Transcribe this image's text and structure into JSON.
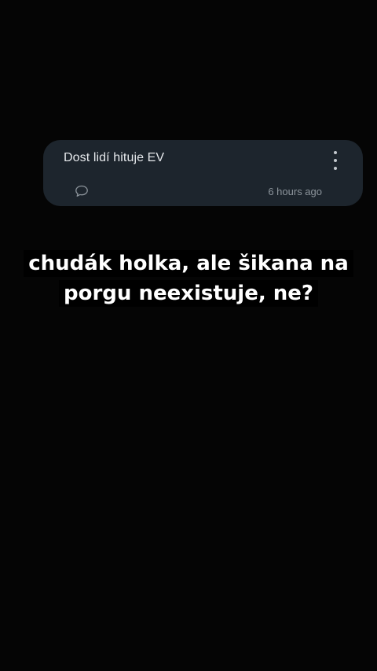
{
  "comment": {
    "text": "Dost lidí hituje EV",
    "timestamp": "6 hours ago",
    "reply_icon": "speech-bubble-icon",
    "menu_icon": "more-vertical-icon"
  },
  "caption": {
    "line1": "chudák holka, ale šikana na",
    "line2": "porgu neexistuje, ne?"
  },
  "colors": {
    "background": "#050505",
    "card": "#1d252d",
    "card_text": "#e6e9ec",
    "timestamp": "#8c949b",
    "caption_text": "#ffffff"
  }
}
